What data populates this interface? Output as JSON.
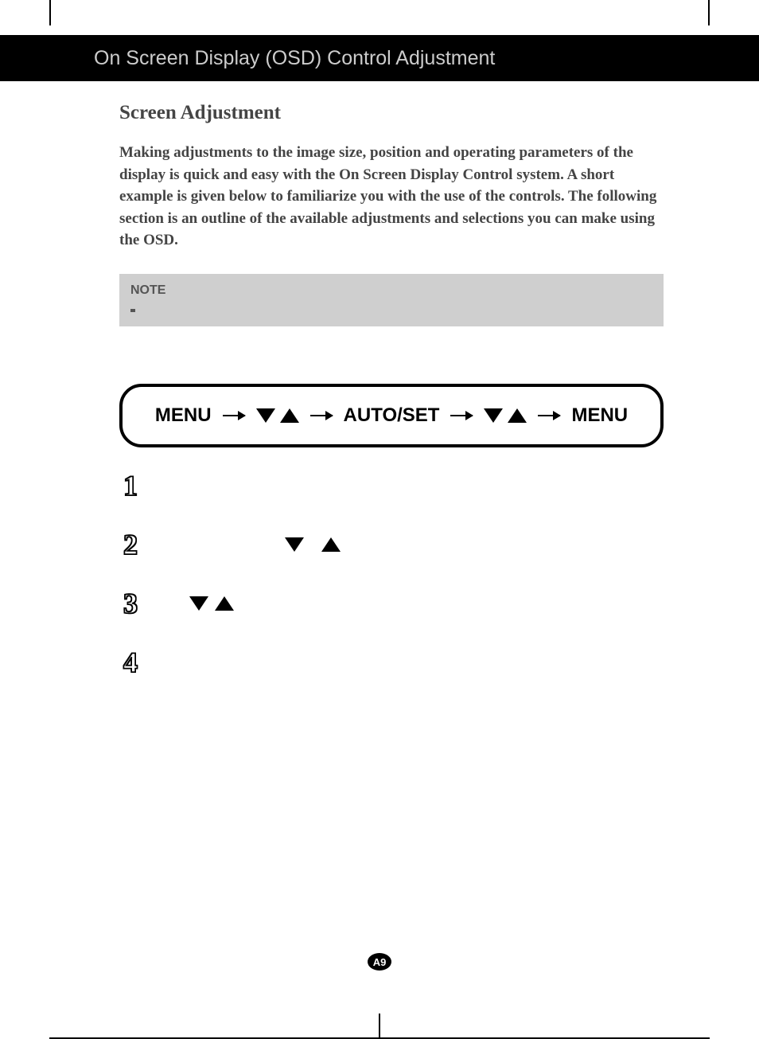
{
  "header": {
    "title": "On Screen Display (OSD) Control Adjustment"
  },
  "subtitle": "Screen Adjustment",
  "intro": "Making adjustments to the image size, position and operating parameters of the display is quick and easy with the On Screen Display Control system. A short example is given below to familiarize you with the use of the controls. The following section is an outline of the available adjustments and selections you can make using the OSD.",
  "note": {
    "label": "NOTE"
  },
  "flow": {
    "item1": "MENU",
    "item2": "AUTO/SET",
    "item3": "MENU"
  },
  "steps": {
    "n1": "1",
    "n2": "2",
    "n3": "3",
    "n4": "4"
  },
  "page_number": "A9"
}
